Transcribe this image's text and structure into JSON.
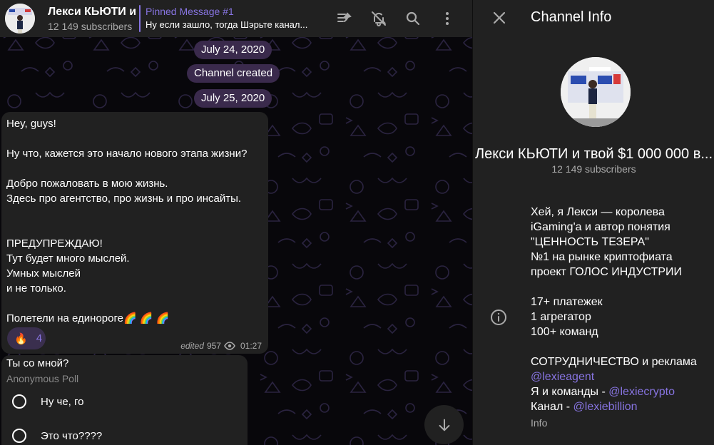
{
  "header": {
    "channel_title": "Лекси КЬЮТИ и твой $1 000 000 в...",
    "subscribers": "12 149 subscribers",
    "pinned_title": "Pinned Message #1",
    "pinned_text": "Ну если зашло, тогда Шэрьте канал..."
  },
  "chat": {
    "date_1": "July 24, 2020",
    "service_msg": "Channel created",
    "date_2": "July 25, 2020",
    "message": {
      "lines": [
        "Hey, guys!",
        "",
        "Ну что, кажется это начало нового этапа жизни?",
        "",
        "Добро пожаловать в мою жизнь.",
        "Здесь про агентство, про жизнь и про инсайты.",
        "",
        "",
        "ПРЕДУПРЕЖДАЮ!",
        "Тут будет много мыслей.",
        "Умных мыслей",
        "и не только.",
        "",
        "Полетели на единороге🌈 🌈 🌈"
      ],
      "reaction_emoji": "🔥",
      "reaction_count": "4",
      "edited_label": "edited",
      "views": "957",
      "time": "01:27"
    },
    "poll": {
      "question": "Ты со мной?",
      "type": "Anonymous Poll",
      "options": [
        "Ну че, го",
        "Это что????"
      ]
    }
  },
  "info": {
    "title": "Channel Info",
    "name": "Лекси КЬЮТИ и твой $1 000 000 в...",
    "subscribers": "12 149 subscribers",
    "bio": {
      "l1": "Хей, я Лекси — королева",
      "l2": "iGaming'а и автор понятия",
      "l3": "\"ЦЕННОСТЬ ТЕЗЕРА\"",
      "l4": "№1 на рынке криптофиата",
      "l5": "проект ГОЛОС ИНДУСТРИИ",
      "l6": "17+ платежек",
      "l7": "1 агрегатор",
      "l8": "100+ команд",
      "l9": "СОТРУДНИЧЕСТВО и реклама",
      "link1": "@lexieagent",
      "l11_prefix": "Я и команды - ",
      "link2": "@lexiecrypto",
      "l12_prefix": "Канал - ",
      "link3": "@lexiebillion"
    },
    "bio_label": "Info"
  },
  "colors": {
    "accent": "#8774e1",
    "panel": "#212121",
    "date_pill": "#3a2a4c"
  }
}
